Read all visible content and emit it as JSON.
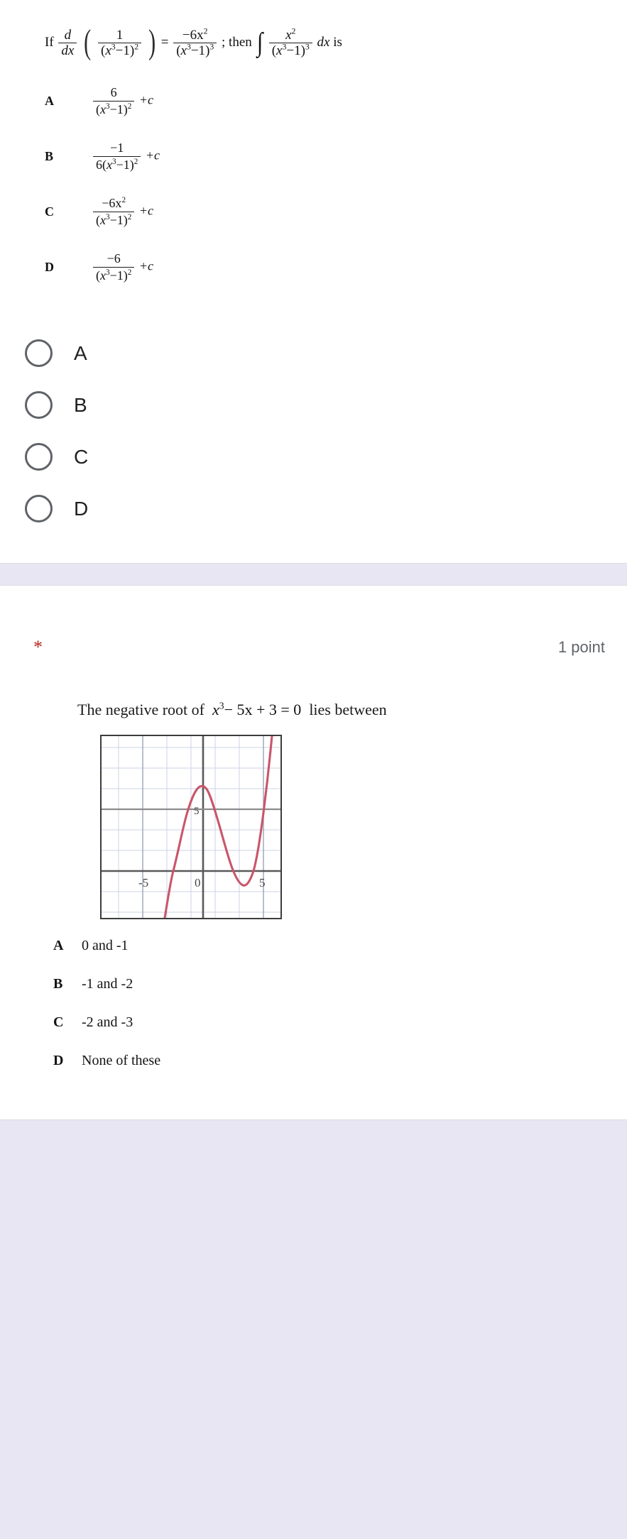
{
  "theme": {
    "page_background": "#e9e6f3",
    "card_background": "#ffffff",
    "card_border": "#dadce0",
    "radio_border": "#5f6368",
    "required_star_color": "#b3261e",
    "points_text_color": "#5f6368",
    "curve_color": "#c9566a",
    "axis_color": "#595959",
    "grid_color": "#c8cfe0"
  },
  "question1": {
    "stem": {
      "if_word": "If",
      "d": "d",
      "dx": "dx",
      "inner_numerator": "1",
      "inner_denominator_base": "x",
      "inner_denominator_exp": "3",
      "inner_denominator_minus": "−1",
      "inner_denominator_power": "2",
      "equals": "=",
      "rhs_numerator": "−6x",
      "rhs_numerator_exp": "2",
      "rhs_denominator_base": "x",
      "rhs_denominator_exp": "3",
      "rhs_denominator_minus": "−1",
      "rhs_denominator_power": "3",
      "semicolon_then": "; then",
      "integral": "∫",
      "int_numerator": "x",
      "int_numerator_exp": "2",
      "int_denominator_base": "x",
      "int_denominator_exp": "3",
      "int_denominator_minus": "−1",
      "int_denominator_power": "3",
      "dx_tail": "dx",
      "is_word": "is",
      "plain_text": "If d/dx ( 1/(x³−1)² ) = −6x²/(x³−1)³ ; then ∫ x²/(x³−1)³ dx  is"
    },
    "image_options": [
      {
        "letter": "A",
        "numerator": "6",
        "denominator_prefix": "",
        "denominator_base": "x",
        "denominator_exp": "3",
        "denominator_minus": "−1",
        "denominator_power": "2",
        "suffix": "+c",
        "plain_text": "6/(x³−1)² + c"
      },
      {
        "letter": "B",
        "numerator": "−1",
        "denominator_prefix": "6",
        "denominator_base": "x",
        "denominator_exp": "3",
        "denominator_minus": "−1",
        "denominator_power": "2",
        "suffix": "+c",
        "plain_text": "−1/6(x³−1)² + c"
      },
      {
        "letter": "C",
        "numerator": "−6x",
        "numerator_exp": "2",
        "denominator_prefix": "",
        "denominator_base": "x",
        "denominator_exp": "3",
        "denominator_minus": "−1",
        "denominator_power": "2",
        "suffix": "+c",
        "plain_text": "−6x²/(x³−1)² + c"
      },
      {
        "letter": "D",
        "numerator": "−6",
        "denominator_prefix": "",
        "denominator_base": "x",
        "denominator_exp": "3",
        "denominator_minus": "−1",
        "denominator_power": "2",
        "suffix": "+c",
        "plain_text": "−6/(x³−1)² + c"
      }
    ],
    "radio_choices": [
      {
        "label": "A",
        "selected": false
      },
      {
        "label": "B",
        "selected": false
      },
      {
        "label": "C",
        "selected": false
      },
      {
        "label": "D",
        "selected": false
      }
    ]
  },
  "question2": {
    "required_marker": "*",
    "points": "1 point",
    "stem": {
      "lead": "The negative root of",
      "eq_base": "x",
      "eq_exp": "3",
      "eq_rest": "− 5x + 3 = 0",
      "tail": "lies between",
      "plain_text": "The negative root of x³ − 5x + 3 = 0  lies between"
    },
    "graph": {
      "x_tick_labels": [
        "-5",
        "0",
        "5"
      ],
      "y_tick_labels": [
        "5"
      ],
      "caption": "Cubic curve y = x³ − 5x + 3"
    },
    "image_options": [
      {
        "letter": "A",
        "text": "0 and -1"
      },
      {
        "letter": "B",
        "text": "-1 and -2"
      },
      {
        "letter": "C",
        "text": "-2 and -3"
      },
      {
        "letter": "D",
        "text": "None of these"
      }
    ]
  },
  "chart_data": {
    "type": "line",
    "title": "",
    "xlabel": "",
    "ylabel": "",
    "xlim": [
      -7,
      7
    ],
    "ylim": [
      -8,
      13
    ],
    "xticks": [
      -5,
      0,
      5
    ],
    "yticks": [
      5
    ],
    "grid": true,
    "legend": "none",
    "series": [
      {
        "name": "y = x^3 - 5x + 3",
        "x": [
          -3.2,
          -3.0,
          -2.8,
          -2.6,
          -2.4,
          -2.2,
          -2.0,
          -1.8,
          -1.6,
          -1.4,
          -1.3,
          -1.2,
          -1.0,
          -0.8,
          -0.6,
          -0.4,
          -0.2,
          0.0,
          0.2,
          0.4,
          0.6,
          0.8,
          1.0,
          1.2,
          1.3,
          1.4,
          1.6,
          1.8,
          2.0,
          2.2,
          2.4,
          2.6,
          2.8,
          3.0
        ],
        "y": [
          -13.8,
          -9.0,
          -4.9,
          -1.6,
          1.2,
          3.3,
          5.0,
          6.2,
          6.9,
          7.3,
          7.3,
          7.3,
          7.0,
          6.5,
          5.8,
          4.9,
          4.0,
          3.0,
          2.0,
          1.1,
          0.2,
          -0.5,
          -1.0,
          -1.3,
          -1.3,
          -1.3,
          -0.9,
          0.2,
          1.0,
          2.6,
          4.8,
          7.6,
          11.0,
          15.0
        ]
      }
    ]
  }
}
